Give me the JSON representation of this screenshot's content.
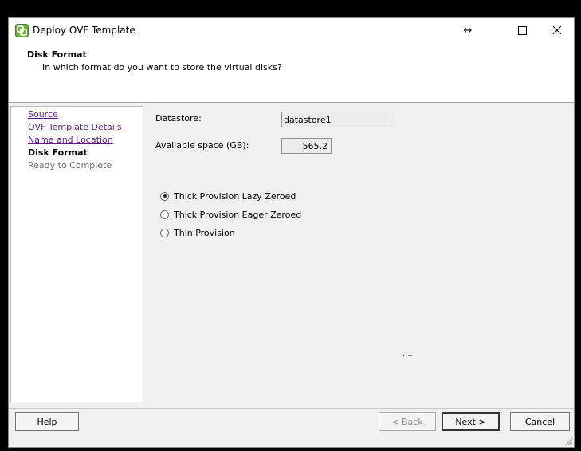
{
  "window": {
    "title": "Deploy OVF Template",
    "controls": {
      "resize": "↔",
      "maximize": "☐",
      "close": "✕"
    }
  },
  "header": {
    "title": "Disk Format",
    "subtitle": "In which format do you want to store the virtual disks?"
  },
  "sidebar": {
    "items": [
      {
        "label": "Source",
        "state": "visited"
      },
      {
        "label": "OVF Template Details",
        "state": "visited"
      },
      {
        "label": "Name and Location",
        "state": "visited"
      },
      {
        "label": "Disk Format",
        "state": "current"
      },
      {
        "label": "Ready to Complete",
        "state": "pending"
      }
    ]
  },
  "form": {
    "datastore_label": "Datastore:",
    "datastore_value": "datastore1",
    "space_label": "Available space (GB):",
    "space_value": "565.2",
    "options": [
      {
        "label": "Thick Provision Lazy Zeroed",
        "selected": true
      },
      {
        "label": "Thick Provision Eager Zeroed",
        "selected": false
      },
      {
        "label": "Thin Provision",
        "selected": false
      }
    ],
    "status_dots": "...."
  },
  "buttons": {
    "help": "Help",
    "back": "< Back",
    "next": "Next >",
    "cancel": "Cancel"
  },
  "colors": {
    "link": "#551a8b",
    "dialog_bg": "#f0f0f0",
    "icon_green": "#6fb33f"
  }
}
